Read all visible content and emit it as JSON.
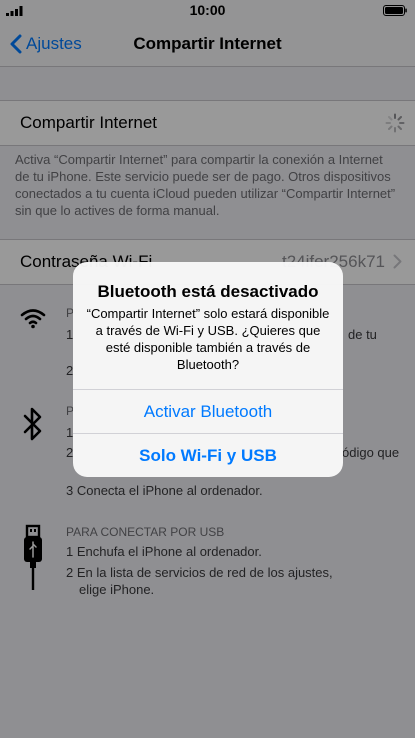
{
  "status_bar": {
    "time": "10:00"
  },
  "nav": {
    "back_label": "Ajustes",
    "title": "Compartir Internet"
  },
  "hotspot_cell": {
    "label": "Compartir Internet"
  },
  "description": "Activa “Compartir Internet” para compartir la conexión a Internet de tu iPhone. Este servicio puede ser de pago. Otros dispositivos conectados a tu cuenta iCloud pueden utilizar “Compartir Internet” sin que lo actives de forma manual.",
  "password_cell": {
    "label": "Contraseña Wi-Fi",
    "value": "t24ifer256k71"
  },
  "wifi_section": {
    "heading": "P",
    "line1": "1",
    "line1_end": "de tu",
    "line2": "2"
  },
  "bt_section": {
    "heading": "P",
    "line1": "1",
    "line2": "2",
    "line2_end": "ódigo que",
    "line3": "3 Conecta el iPhone al ordenador."
  },
  "usb_section": {
    "heading": "PARA CONECTAR POR USB",
    "line1": "1 Enchufa el iPhone al ordenador.",
    "line2": "2 En la lista de servicios de red de los ajustes,",
    "line2b": "elige iPhone."
  },
  "alert": {
    "title": "Bluetooth está desactivado",
    "message": "“Compartir Internet” solo estará disponible a través de Wi-Fi y USB. ¿Quieres que esté disponible también a través de Bluetooth?",
    "button_1": "Activar Bluetooth",
    "button_2": "Solo Wi-Fi y USB"
  },
  "colors": {
    "accent": "#007aff",
    "background": "#efeff4"
  }
}
